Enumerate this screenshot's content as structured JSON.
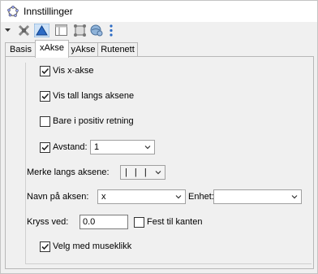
{
  "window": {
    "title": "Innstillinger"
  },
  "toolbar": {
    "icons": [
      "menu-arrow-icon",
      "point-icon",
      "graphics-icon",
      "algebra-icon",
      "layout-icon",
      "globe-icon",
      "more-icon"
    ]
  },
  "tabs": [
    {
      "label": "Basis",
      "active": false
    },
    {
      "label": "xAkse",
      "active": true
    },
    {
      "label": "yAkse",
      "active": false
    },
    {
      "label": "Rutenett",
      "active": false
    }
  ],
  "xaxis": {
    "show_axis": {
      "label": "Vis x-akse",
      "checked": true
    },
    "show_numbers": {
      "label": "Vis tall langs aksene",
      "checked": true
    },
    "positive_only": {
      "label": "Bare i positiv retning",
      "checked": false
    },
    "distance": {
      "label": "Avstand:",
      "checked": true,
      "value": "1"
    },
    "ticks": {
      "label": "Merke langs aksene:",
      "value": "| | |"
    },
    "axis_name": {
      "label": "Navn på aksen:",
      "value": "x"
    },
    "unit": {
      "label": "Enhet:",
      "value": ""
    },
    "cross_at": {
      "label": "Kryss ved:",
      "value": "0.0"
    },
    "fix_edge": {
      "label": "Fest til kanten",
      "checked": false
    },
    "select_mouse": {
      "label": "Velg med museklikk",
      "checked": true
    }
  }
}
